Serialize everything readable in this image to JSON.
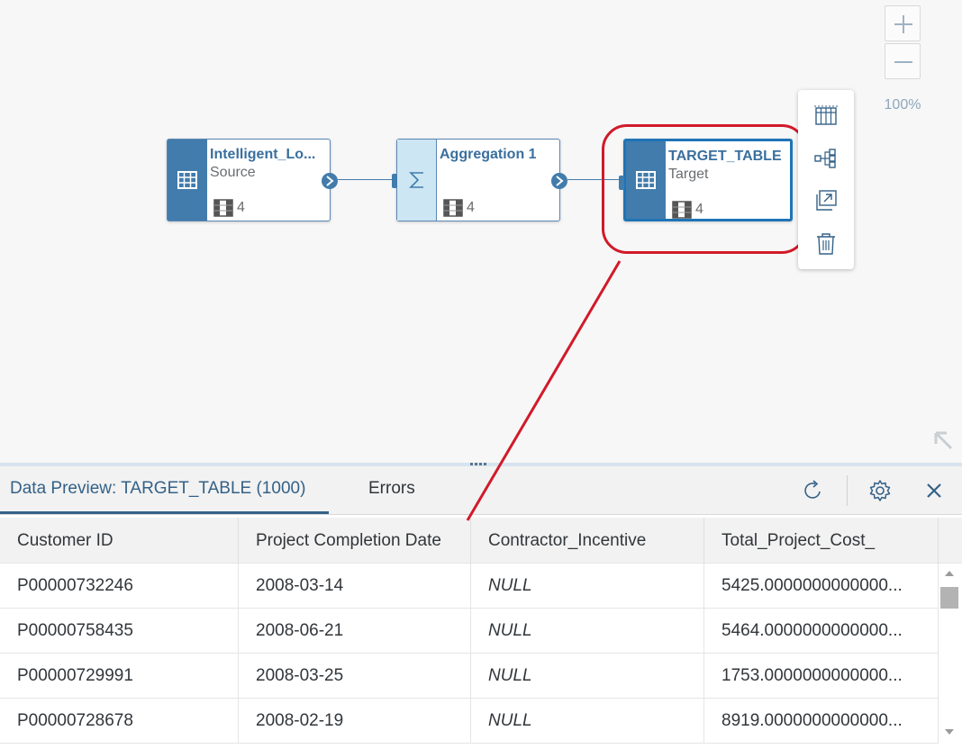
{
  "zoom": {
    "in_icon": "plus-icon",
    "out_icon": "minus-icon",
    "level": "100%"
  },
  "nodes": [
    {
      "title": "Intelligent_Lo...",
      "subtitle": "Source",
      "count": "4",
      "icon": "table-icon"
    },
    {
      "title": "Aggregation 1",
      "subtitle": "",
      "count": "4",
      "icon": "sigma-icon"
    },
    {
      "title": "TARGET_TABLE",
      "subtitle": "Target",
      "count": "4",
      "icon": "table-icon"
    }
  ],
  "node_toolbar": [
    "columns-icon",
    "lineage-icon",
    "open-in-new-icon",
    "delete-icon"
  ],
  "annotation": {
    "color": "#d11a2a"
  },
  "preview": {
    "tabs": [
      "Data Preview: TARGET_TABLE (1000)",
      "Errors"
    ],
    "actions": [
      "refresh-icon",
      "settings-icon",
      "close-icon"
    ],
    "columns": [
      "Customer ID",
      "Project Completion Date",
      "Contractor_Incentive",
      "Total_Project_Cost_"
    ],
    "rows": [
      [
        "P00000732246",
        "2008-03-14",
        "NULL",
        "5425.0000000000000..."
      ],
      [
        "P00000758435",
        "2008-06-21",
        "NULL",
        "5464.0000000000000..."
      ],
      [
        "P00000729991",
        "2008-03-25",
        "NULL",
        "1753.0000000000000..."
      ],
      [
        "P00000728678",
        "2008-02-19",
        "NULL",
        "8919.0000000000000..."
      ]
    ]
  },
  "colors": {
    "accent": "#346187",
    "node_band": "#427cac",
    "highlight": "#d11a2a"
  }
}
